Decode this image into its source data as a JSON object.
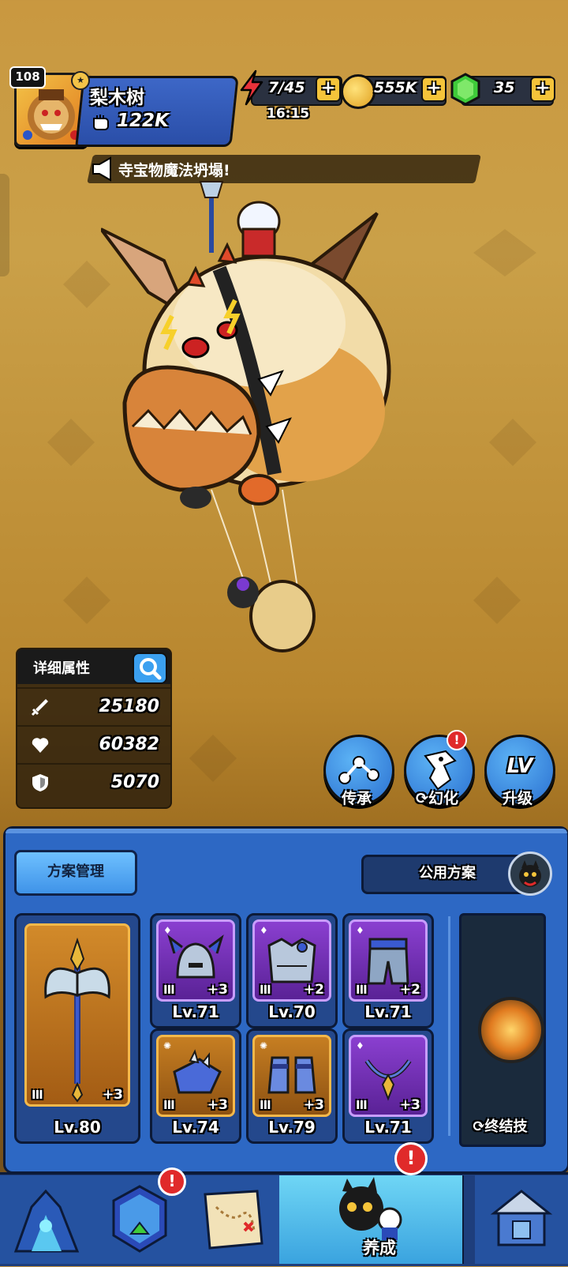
{
  "player": {
    "level": "108",
    "name": "梨木树",
    "power": "122K"
  },
  "resources": {
    "energy": "7/45",
    "energy_timer": "16:15",
    "gold": "555K",
    "gems": "35",
    "plus": "+"
  },
  "ticker": {
    "prefix": "寺宝物",
    "highlight": "魔法坍塌!"
  },
  "stats": {
    "title": "详细属性",
    "attack": "25180",
    "health": "60382",
    "defense": "5070"
  },
  "actions": {
    "inherit": "传承",
    "transform": "幻化",
    "upgrade": "升级",
    "upgrade_icon": "LV",
    "alert": "!"
  },
  "equipment": {
    "scheme_button": "方案管理",
    "shared_button": "公用方案",
    "weapon": {
      "tier": "III",
      "plus": "+3",
      "level": "Lv.80"
    },
    "slots": [
      {
        "tier": "III",
        "plus": "+3",
        "level": "Lv.71",
        "rarity": "purple",
        "icon": "helmet-icon"
      },
      {
        "tier": "III",
        "plus": "+2",
        "level": "Lv.70",
        "rarity": "purple",
        "icon": "chest-armor-icon"
      },
      {
        "tier": "III",
        "plus": "+2",
        "level": "Lv.71",
        "rarity": "purple",
        "icon": "pants-icon"
      },
      {
        "tier": "III",
        "plus": "+3",
        "level": "Lv.74",
        "rarity": "gold",
        "icon": "gauntlet-icon"
      },
      {
        "tier": "III",
        "plus": "+3",
        "level": "Lv.79",
        "rarity": "gold",
        "icon": "boots-icon"
      },
      {
        "tier": "III",
        "plus": "+3",
        "level": "Lv.71",
        "rarity": "purple",
        "icon": "necklace-icon"
      }
    ],
    "finisher_label": "终结技"
  },
  "nav": {
    "active_label": "养成",
    "alert": "!"
  },
  "colors": {
    "panel_blue": "#2d68c4",
    "purple_rarity": "#8a3fd0",
    "gold_rarity": "#c67e22",
    "alert_red": "#e02a2a"
  }
}
